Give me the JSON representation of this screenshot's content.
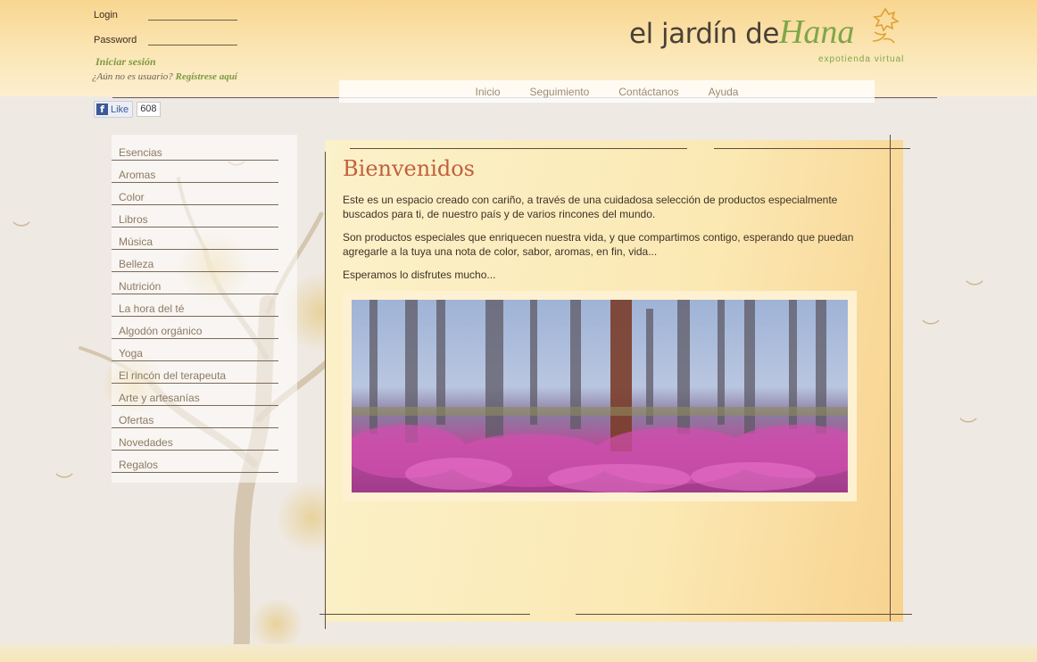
{
  "login": {
    "login_label": "Login",
    "password_label": "Password",
    "login_value": "",
    "password_value": "",
    "signin_link": "Iniciar sesión",
    "register_prompt": "¿Aún no es usuario?",
    "register_link": "Regístrese aquí"
  },
  "facebook": {
    "like_label": "Like",
    "like_count": "608"
  },
  "logo": {
    "main": "el jardín de",
    "script": "Hana",
    "tagline": "expotienda virtual"
  },
  "nav": {
    "items": [
      "Inicio",
      "Seguimiento",
      "Contáctanos",
      "Ayuda"
    ]
  },
  "sidebar": {
    "items": [
      "Esencias",
      "Aromas",
      "Color",
      "Libros",
      "Música",
      "Belleza",
      "Nutrición",
      "La hora del té",
      "Algodón orgánico",
      "Yoga",
      "El rincón del terapeuta",
      "Arte y artesanías",
      "Ofertas",
      "Novedades",
      "Regalos"
    ]
  },
  "content": {
    "title": "Bienvenidos",
    "paragraphs": [
      "Este es un espacio creado con cariño, a través de una cuidadosa selección de productos especialmente buscados para ti, de nuestro país y de varios rincones del mundo.",
      "Son productos especiales que enriquecen nuestra vida, y que compartimos contigo, esperando que puedan agregarle a la tuya una nota de color, sabor, aromas, en fin, vida...",
      "Esperamos lo disfrutes mucho..."
    ]
  },
  "colors": {
    "accent_green": "#7fa54a",
    "title_red": "#c2603c",
    "nav_text": "#9d8a72"
  }
}
